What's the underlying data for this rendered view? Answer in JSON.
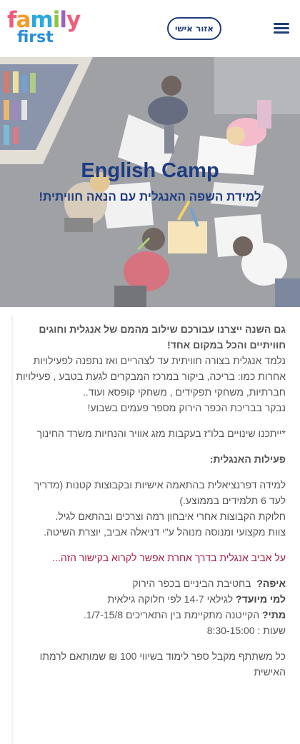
{
  "header": {
    "logo_line1": "family",
    "logo_line2": "first",
    "personal_area_label": "אזור אישי",
    "menu_icon": "hamburger-menu-icon"
  },
  "hero": {
    "title": "English Camp",
    "subtitle": "למידת השפה האנגלית עם הנאה חוויתית!"
  },
  "content": {
    "intro_bold_1": "גם השנה ייצרנו עבורכם שילוב מהמם של אנגלית וחוגים",
    "intro_bold_2": "חוויתיים והכל במקום אחד!",
    "intro_1": "נלמד אנגלית בצורה חוויתית עד לצהריים ואז נתפנה לפעילויות",
    "intro_2": "אחרות כמו: בריכה, ביקור במרכז המבקרים לגעת בטבע , פעילויות",
    "intro_3": "חברתיות, משחקי תפקידים , משחקי קופסא ועוד..",
    "intro_4": "נבקר בבריכת הכפר הירוק מספר פעמים בשבוע!",
    "note": "*ייתכנו שינויים בלו\"ז בעקבות מזג אוויר והנחיות משרד החינוך",
    "activities_title": "פעילות האנגלית:",
    "act_1": "למידה דפרנציאלית בהתאמה אישיות ובקבוצות קטנות (מדריך",
    "act_2": "לעד 6 תלמידים בממוצע.)",
    "act_3": "חלוקת הקבוצות אחרי איבחון רמה וצרכים ובהתאם לגיל.",
    "act_4": "צוות מקצועי ומנוסה מנוהל ע\"י דניאלה אביב, יוצרת השיטה.",
    "link_text": "על אביב אנגלית בדרך אחרת אפשר לקרוא בקישור הזה...",
    "where_label": "איפה?",
    "where_value": "בחטיבת הביניים בכפר הירוק",
    "for_label": "למי מיועד?",
    "for_value": "לגילאי 14-7 לפי חלוקה גילאית",
    "when_label": "מתי?",
    "when_value": "הקייטנה מתקיימת בין התאריכים 1/7-15/8.",
    "hours": "שעות : 8:30-15:00",
    "prize_1": "כל משתתף מקבל ספר לימוד בשיווי 100 ₪ שמותאם לרמתו",
    "prize_2": "האישית"
  }
}
